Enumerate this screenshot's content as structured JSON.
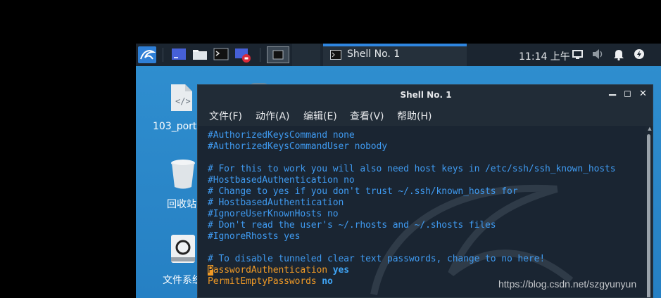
{
  "panel": {
    "task_label": "Shell No. 1",
    "clock": "11:14 上午"
  },
  "desktop": {
    "icons": [
      {
        "label": "103_port"
      },
      {
        "label": "回收站"
      },
      {
        "label": "文件系统"
      }
    ]
  },
  "terminal": {
    "title": "Shell No. 1",
    "menus": [
      "文件(F)",
      "动作(A)",
      "编辑(E)",
      "查看(V)",
      "帮助(H)"
    ],
    "lines": [
      "#AuthorizedKeysCommand none",
      "#AuthorizedKeysCommandUser nobody",
      "",
      "# For this to work you will also need host keys in /etc/ssh/ssh_known_hosts",
      "#HostbasedAuthentication no",
      "# Change to yes if you don't trust ~/.ssh/known_hosts for",
      "# HostbasedAuthentication",
      "#IgnoreUserKnownHosts no",
      "# Don't read the user's ~/.rhosts and ~/.shosts files",
      "#IgnoreRhosts yes",
      "",
      "# To disable tunneled clear text passwords, change to no here!"
    ],
    "cursor_char": "P",
    "pw_key_rest": "asswordAuthentication",
    "pw_value": "yes",
    "empty_key": "PermitEmptyPasswords",
    "empty_value": "no"
  },
  "watermark": "https://blog.csdn.net/szgyunyun",
  "colors": {
    "panel_bg": "#1b2530",
    "terminal_bg": "#1a2532",
    "comment_blue": "#3f9af0",
    "keyword_orange": "#f09a26",
    "accent_blue": "#2f86e0",
    "desktop_blue": "#2a86c8"
  }
}
